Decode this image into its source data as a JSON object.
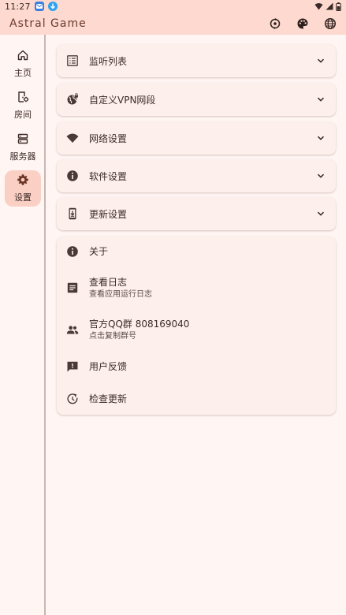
{
  "status_bar": {
    "time": "11:27"
  },
  "app_bar": {
    "title": "Astral Game",
    "actions": [
      "sync-icon",
      "palette-icon",
      "globe-icon"
    ]
  },
  "rail": {
    "items": [
      {
        "label": "主页",
        "icon": "home-icon"
      },
      {
        "label": "房间",
        "icon": "room-icon"
      },
      {
        "label": "服务器",
        "icon": "server-icon"
      },
      {
        "label": "设置",
        "icon": "gear-icon",
        "active": true
      }
    ]
  },
  "settings": {
    "sections": [
      {
        "label": "监听列表",
        "icon": "list-icon"
      },
      {
        "label": "自定义VPN网段",
        "icon": "vpn-globe-icon"
      },
      {
        "label": "网络设置",
        "icon": "wifi-icon"
      },
      {
        "label": "软件设置",
        "icon": "info-icon"
      },
      {
        "label": "更新设置",
        "icon": "phone-download-icon"
      }
    ],
    "about": [
      {
        "title": "关于",
        "subtitle": "",
        "icon": "info-icon"
      },
      {
        "title": "查看日志",
        "subtitle": "查看应用运行日志",
        "icon": "log-icon"
      },
      {
        "title": "官方QQ群 808169040",
        "subtitle": "点击复制群号",
        "icon": "group-icon"
      },
      {
        "title": "用户反馈",
        "subtitle": "",
        "icon": "feedback-icon"
      },
      {
        "title": "检查更新",
        "subtitle": "",
        "icon": "update-icon"
      }
    ]
  },
  "colors": {
    "accent": "#fdd9cf",
    "active_bg": "#fbd0c4",
    "icon": "#4a3a37",
    "primary_text": "#3a2a27"
  }
}
